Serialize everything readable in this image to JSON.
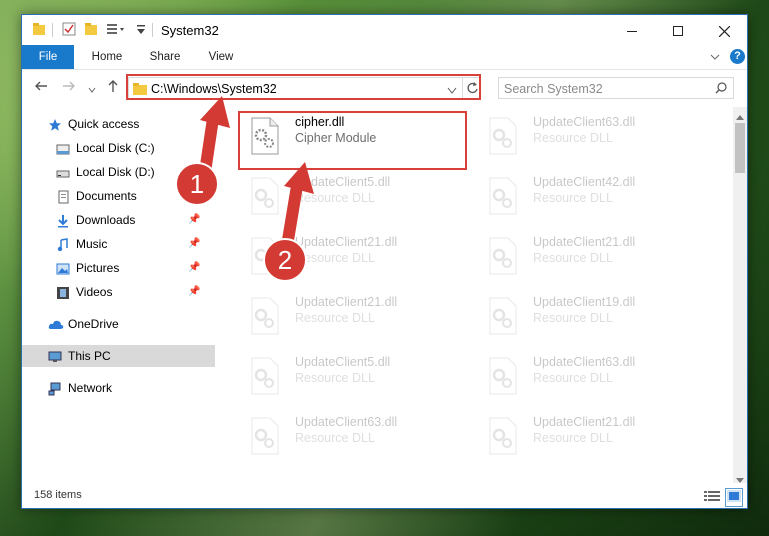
{
  "window": {
    "title": "System32"
  },
  "ribbon": {
    "tabs": [
      "File",
      "Home",
      "Share",
      "View"
    ]
  },
  "address": {
    "path": "C:\\Windows\\System32"
  },
  "search": {
    "placeholder": "Search System32"
  },
  "nav": {
    "items": [
      {
        "label": "Quick access",
        "icon": "star-icon",
        "pinned": false
      },
      {
        "label": "Local Disk (C:)",
        "icon": "drive-icon",
        "pinned": false
      },
      {
        "label": "Local Disk (D:)",
        "icon": "drive-icon",
        "pinned": false
      },
      {
        "label": "Documents",
        "icon": "documents-icon",
        "pinned": false
      },
      {
        "label": "Downloads",
        "icon": "download-icon",
        "pinned": true
      },
      {
        "label": "Music",
        "icon": "music-icon",
        "pinned": true
      },
      {
        "label": "Pictures",
        "icon": "pictures-icon",
        "pinned": true
      },
      {
        "label": "Videos",
        "icon": "videos-icon",
        "pinned": true
      },
      {
        "label": "OneDrive",
        "icon": "cloud-icon",
        "pinned": false
      },
      {
        "label": "This PC",
        "icon": "computer-icon",
        "pinned": false,
        "selected": true
      },
      {
        "label": "Network",
        "icon": "network-icon",
        "pinned": false
      }
    ]
  },
  "files": [
    {
      "name": "cipher.dll",
      "type": "Cipher Module",
      "highlighted": true
    },
    {
      "name": "UpdateClient63.dll",
      "type": "Resource DLL"
    },
    {
      "name": "UpdateClient5.dll",
      "type": "Resource DLL"
    },
    {
      "name": "UpdateClient42.dll",
      "type": "Resource DLL"
    },
    {
      "name": "UpdateClient21.dll",
      "type": "Resource DLL"
    },
    {
      "name": "UpdateClient21.dll",
      "type": "Resource DLL"
    },
    {
      "name": "UpdateClient21.dll",
      "type": "Resource DLL"
    },
    {
      "name": "UpdateClient19.dll",
      "type": "Resource DLL"
    },
    {
      "name": "UpdateClient5.dll",
      "type": "Resource DLL"
    },
    {
      "name": "UpdateClient63.dll",
      "type": "Resource DLL"
    },
    {
      "name": "UpdateClient63.dll",
      "type": "Resource DLL"
    },
    {
      "name": "UpdateClient21.dll",
      "type": "Resource DLL"
    }
  ],
  "status": {
    "item_count": "158 items"
  },
  "callouts": [
    "1",
    "2"
  ],
  "colors": {
    "accent": "#1979ca",
    "highlight_red": "#d9403a",
    "callout_red": "#d23a33"
  }
}
